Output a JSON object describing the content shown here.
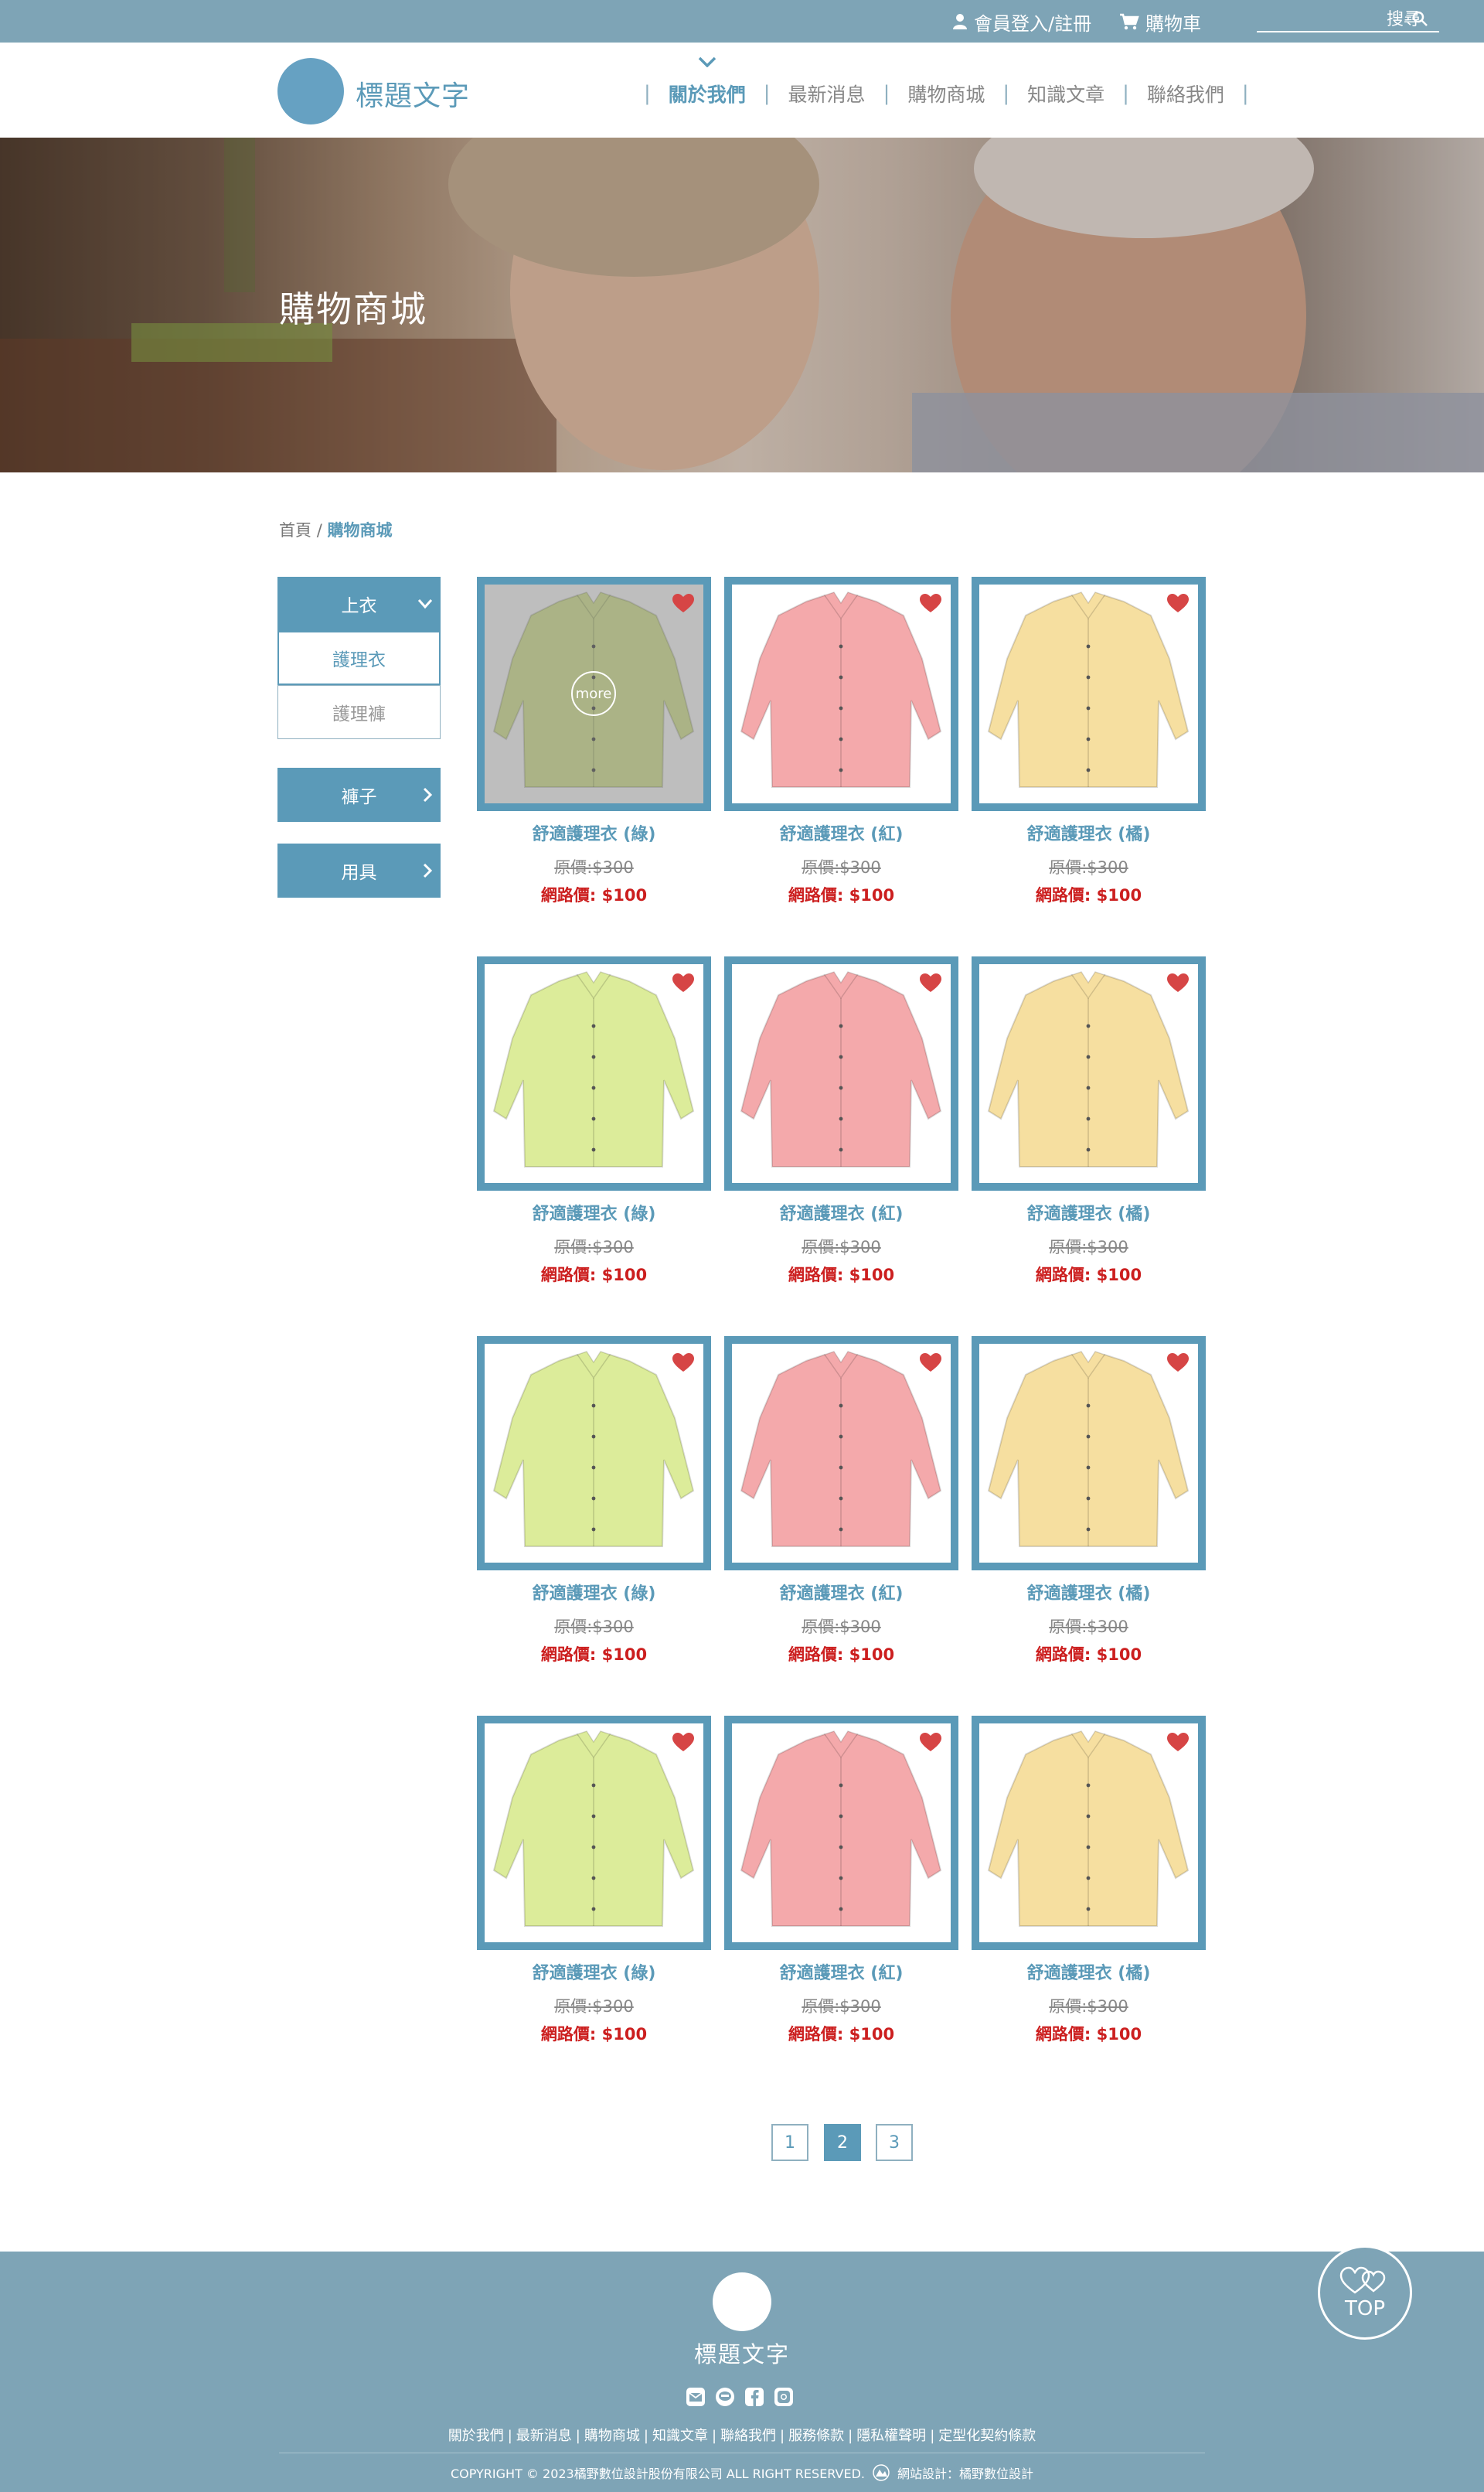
{
  "topbar": {
    "member_label": "會員登入/註冊",
    "cart_label": "購物車",
    "search_placeholder": "搜尋"
  },
  "header": {
    "logo_text": "標題文字",
    "nav": [
      "關於我們",
      "最新消息",
      "購物商城",
      "知識文章",
      "聯絡我們"
    ],
    "active_nav": "關於我們"
  },
  "banner": {
    "title": "購物商城"
  },
  "breadcrumb": {
    "home": "首頁",
    "separator": "/",
    "current": "購物商城"
  },
  "sidebar": {
    "category_main": "上衣",
    "sub_active": "護理衣",
    "sub_inactive": "護理褲",
    "category_2": "褲子",
    "category_3": "用具"
  },
  "products": [
    {
      "name": "舒適護理衣 (綠)",
      "orig": "原價:$300",
      "sale": "網路價: $100",
      "color": "green"
    },
    {
      "name": "舒適護理衣 (紅)",
      "orig": "原價:$300",
      "sale": "網路價: $100",
      "color": "pink"
    },
    {
      "name": "舒適護理衣 (橘)",
      "orig": "原價:$300",
      "sale": "網路價: $100",
      "color": "yellow"
    },
    {
      "name": "舒適護理衣 (綠)",
      "orig": "原價:$300",
      "sale": "網路價: $100",
      "color": "green"
    },
    {
      "name": "舒適護理衣 (紅)",
      "orig": "原價:$300",
      "sale": "網路價: $100",
      "color": "pink"
    },
    {
      "name": "舒適護理衣 (橘)",
      "orig": "原價:$300",
      "sale": "網路價: $100",
      "color": "yellow"
    },
    {
      "name": "舒適護理衣 (綠)",
      "orig": "原價:$300",
      "sale": "網路價: $100",
      "color": "green"
    },
    {
      "name": "舒適護理衣 (紅)",
      "orig": "原價:$300",
      "sale": "網路價: $100",
      "color": "pink"
    },
    {
      "name": "舒適護理衣 (橘)",
      "orig": "原價:$300",
      "sale": "網路價: $100",
      "color": "yellow"
    },
    {
      "name": "舒適護理衣 (綠)",
      "orig": "原價:$300",
      "sale": "網路價: $100",
      "color": "green"
    },
    {
      "name": "舒適護理衣 (紅)",
      "orig": "原價:$300",
      "sale": "網路價: $100",
      "color": "pink"
    },
    {
      "name": "舒適護理衣 (橘)",
      "orig": "原價:$300",
      "sale": "網路價: $100",
      "color": "yellow"
    }
  ],
  "more_label": "more",
  "pagination": {
    "pages": [
      "1",
      "2",
      "3"
    ],
    "current": "2"
  },
  "footer": {
    "title": "標題文字",
    "links": [
      "關於我們",
      "最新消息",
      "購物商城",
      "知識文章",
      "聯絡我們",
      "服務條款",
      "隱私權聲明",
      "定型化契約條款"
    ],
    "copyright": "COPYRIGHT © 2023橘野數位設計股份有限公司 ALL RIGHT RESERVED.",
    "designer": "網站設計：橘野數位設計",
    "top_label": "TOP"
  },
  "colors": {
    "accent": "#5b9ab8",
    "topbar": "#7ea4b6",
    "sale_red": "#cc1f1f",
    "shirt_green": "#dcec9a",
    "shirt_pink": "#f4a9ab",
    "shirt_yellow": "#f6dfa0"
  },
  "icons": [
    "user-icon",
    "cart-icon",
    "search-icon",
    "chevron-down-icon",
    "heart-icon",
    "chevron-right-icon",
    "mail-icon",
    "line-icon",
    "facebook-icon",
    "instagram-icon",
    "top-hearts-icon"
  ]
}
